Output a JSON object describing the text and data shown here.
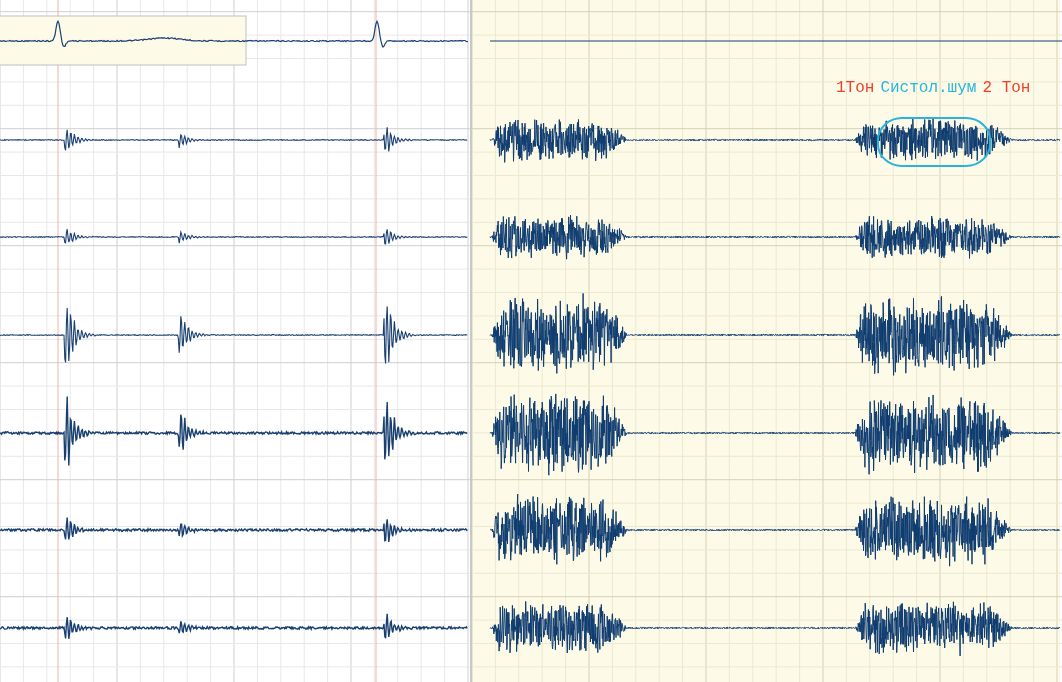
{
  "sound_labels": [
    {
      "text": "1Тон",
      "color": "#f0402c"
    },
    {
      "text": "Систол.шум",
      "color": "#2ab4dc"
    },
    {
      "text": "2 Тон",
      "color": "#f0402c"
    }
  ]
}
